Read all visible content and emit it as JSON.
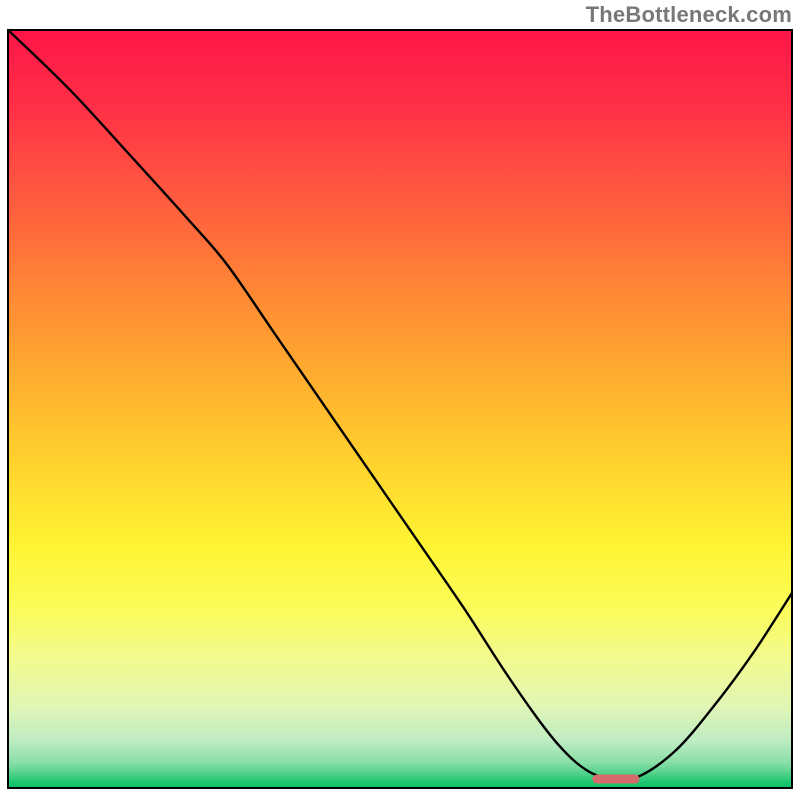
{
  "watermark": "TheBottleneck.com",
  "chart_data": {
    "type": "line",
    "title": "",
    "xlabel": "",
    "ylabel": "",
    "xlim": [
      0,
      100
    ],
    "ylim": [
      0,
      100
    ],
    "gradient": "bottleneck spectrum (red high → green low)",
    "series": [
      {
        "name": "bottleneck-curve",
        "x": [
          0,
          8,
          16,
          23,
          28,
          34,
          40,
          46,
          52,
          58,
          63,
          67,
          70,
          73,
          76,
          80,
          85,
          90,
          95,
          100
        ],
        "y": [
          100,
          92,
          83,
          75,
          69,
          60,
          51,
          42,
          33,
          24,
          16,
          10,
          6,
          3,
          1.5,
          1.5,
          5,
          11,
          18,
          26
        ]
      }
    ],
    "marker": {
      "name": "optimal-range",
      "x": 77.5,
      "y": 1.3,
      "width_pct": 6.0
    }
  }
}
